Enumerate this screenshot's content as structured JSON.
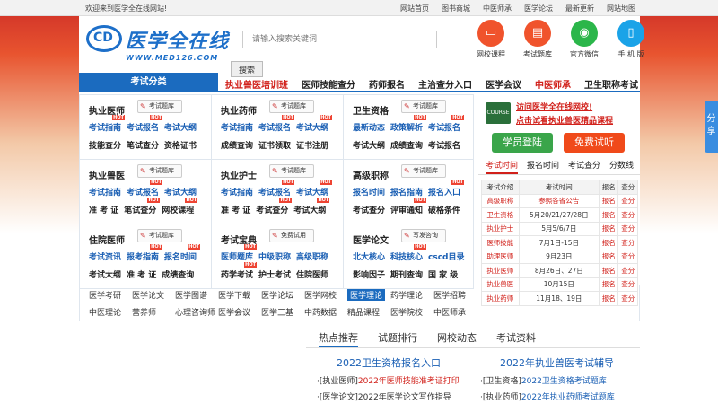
{
  "topbar": {
    "welcome": "欢迎来到医学全在线网站!",
    "links": [
      "网站首页",
      "图书商城",
      "中医师承",
      "医学论坛",
      "最新更新",
      "网站地图"
    ]
  },
  "header": {
    "logo_text": "医学全在线",
    "logo_url": "WWW.MED126.COM",
    "search_placeholder": "请输入搜索关键词",
    "search_button": "搜索",
    "quick_links": [
      {
        "label": "网校课程",
        "icon": "monitor-icon",
        "color": "#f0532c"
      },
      {
        "label": "考试题库",
        "icon": "book-icon",
        "color": "#f0532c"
      },
      {
        "label": "官方微信",
        "icon": "wechat-icon",
        "color": "#2bb64a"
      },
      {
        "label": "手 机 版",
        "icon": "phone-icon",
        "color": "#1aa3e8"
      }
    ]
  },
  "nav": {
    "category": "考试分类",
    "items": [
      {
        "label": "执业兽医培训班",
        "red": true
      },
      {
        "label": "医师技能查分",
        "red": false
      },
      {
        "label": "药师报名",
        "red": false
      },
      {
        "label": "主治查分入口",
        "red": false
      },
      {
        "label": "医学会议",
        "red": false
      },
      {
        "label": "中医师承",
        "red": true
      },
      {
        "label": "卫生职称考试",
        "red": false
      }
    ]
  },
  "exams": [
    {
      "name": "执业医师",
      "btn": "考试题库",
      "r1": [
        "考试指南",
        "考试报名",
        "考试大纲"
      ],
      "r2": [
        "技能查分",
        "笔试查分",
        "资格证书"
      ]
    },
    {
      "name": "执业药师",
      "btn": "考试题库",
      "r1": [
        "考试指南",
        "考试报名",
        "考试大纲"
      ],
      "r2": [
        "成绩查询",
        "证书领取",
        "证书注册"
      ]
    },
    {
      "name": "卫生资格",
      "btn": "考试题库",
      "r1": [
        "最新动态",
        "政策解析",
        "考试报名"
      ],
      "r2": [
        "考试大纲",
        "成绩查询",
        "考试报名"
      ]
    },
    {
      "name": "执业兽医",
      "btn": "考试题库",
      "r1": [
        "考试指南",
        "考试报名",
        "考试大纲"
      ],
      "r2": [
        "准 考 证",
        "笔试查分",
        "网校课程"
      ]
    },
    {
      "name": "执业护士",
      "btn": "考试题库",
      "r1": [
        "考试指南",
        "考试报名",
        "考试大纲"
      ],
      "r2": [
        "准 考 证",
        "考试查分",
        "考试大纲"
      ]
    },
    {
      "name": "高级职称",
      "btn": "考试题库",
      "r1": [
        "报名时间",
        "报名指南",
        "报名入口"
      ],
      "r2": [
        "考试查分",
        "评审通知",
        "破格条件"
      ]
    },
    {
      "name": "住院医师",
      "btn": "考试题库",
      "r1": [
        "考试资讯",
        "报考指南",
        "报名时间"
      ],
      "r2": [
        "考试大纲",
        "准 考 证",
        "成绩查询"
      ]
    },
    {
      "name": "考试宝典",
      "btn": "免费试用",
      "r1": [
        "医师题库",
        "中级职称",
        "高级职称"
      ],
      "r2": [
        "药学考试",
        "护士考试",
        "住院医师"
      ]
    },
    {
      "name": "医学论文",
      "btn": "写发咨询",
      "r1": [
        "北大核心",
        "科技核心",
        "cscd目录"
      ],
      "r2": [
        "影响因子",
        "期刊查询",
        "国 家 级"
      ]
    }
  ],
  "ad": {
    "badge": "COURSE",
    "line1": "访问医学全在线网校!",
    "line2": "点击试看执业兽医精品课程",
    "btn_login": "学员登陆",
    "btn_free": "免费试听"
  },
  "sched_tabs": [
    "考试时间",
    "报名时间",
    "考试查分",
    "分数线"
  ],
  "schedule": {
    "headers": [
      "考试介绍",
      "考试时间",
      "报名",
      "查分"
    ],
    "rows": [
      [
        "高级职称",
        "参照各省公告",
        "报名",
        "查分"
      ],
      [
        "卫生资格",
        "5月20/21/27/28日",
        "报名",
        "查分"
      ],
      [
        "执业护士",
        "5月5/6/7日",
        "报名",
        "查分"
      ],
      [
        "医师技能",
        "7月1日-15日",
        "报名",
        "查分"
      ],
      [
        "助理医师",
        "9月23日",
        "报名",
        "查分"
      ],
      [
        "执业医师",
        "8月26日、27日",
        "报名",
        "查分"
      ],
      [
        "执业兽医",
        "10月15日",
        "报名",
        "查分"
      ],
      [
        "执业药师",
        "11月18、19日",
        "报名",
        "查分"
      ]
    ]
  },
  "sub_links": {
    "row1": [
      "医学考研",
      "医学论文",
      "医学图谱",
      "医学下载",
      "医学论坛",
      "医学网校",
      "医学理论",
      "药学理论",
      "医学招聘"
    ],
    "row2": [
      "中医理论",
      "营养师",
      "心理咨询师",
      "医学会议",
      "医学三基",
      "中药数据",
      "精品课程",
      "医学院校",
      "中医师承"
    ],
    "active": "医学理论"
  },
  "news_tabs": [
    "热点推荐",
    "试题排行",
    "网校动态",
    "考试资料"
  ],
  "news": {
    "left_head": "2022卫生资格报名入口",
    "left": [
      {
        "tag": "[执业医师]",
        "text": "2022年医师技能准考证打印"
      },
      {
        "tag": "[医学论文]",
        "text": "2022年医学论文写作指导"
      }
    ],
    "right_head": "2022年执业兽医考试辅导",
    "right": [
      {
        "tag": "[卫生资格]",
        "text": "2022卫生资格考试题库"
      },
      {
        "tag": "[执业药师]",
        "text": "2022年执业药师考试题库"
      }
    ]
  },
  "share_label": "分享"
}
